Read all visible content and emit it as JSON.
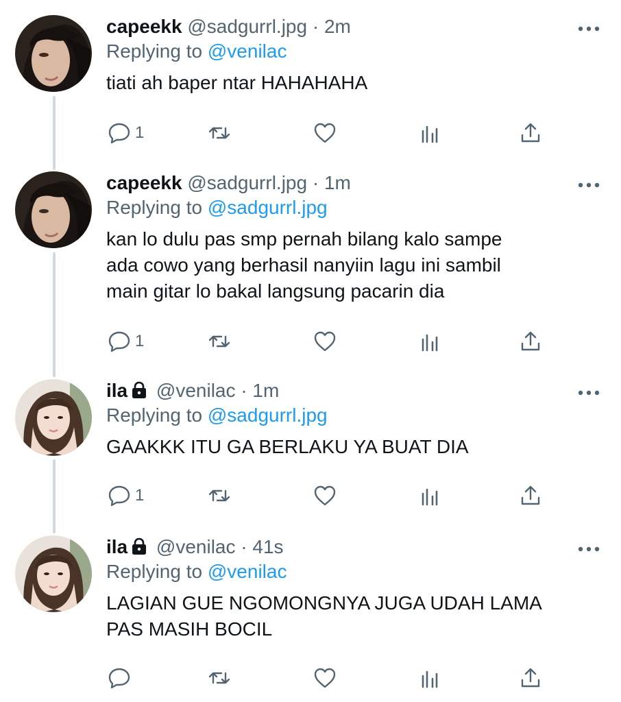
{
  "tweets": [
    {
      "name": "capeekk",
      "protected": false,
      "handle": "@sadgurrl.jpg",
      "sep": "·",
      "time": "2m",
      "replying_label": "Replying to",
      "replying_to": "@venilac",
      "text": "tiati ah baper ntar HAHAHAHA",
      "reply_count": "1",
      "avatar": "dark-hair-selfie"
    },
    {
      "name": "capeekk",
      "protected": false,
      "handle": "@sadgurrl.jpg",
      "sep": "·",
      "time": "1m",
      "replying_label": "Replying to",
      "replying_to": "@sadgurrl.jpg",
      "text": "kan lo dulu pas smp pernah bilang kalo sampe\nada cowo yang berhasil nanyiin lagu ini sambil\nmain gitar lo bakal langsung pacarin dia",
      "reply_count": "1",
      "avatar": "dark-hair-selfie"
    },
    {
      "name": "ila",
      "protected": true,
      "handle": "@venilac",
      "sep": "·",
      "time": "1m",
      "replying_label": "Replying to",
      "replying_to": "@sadgurrl.jpg",
      "text": "GAAKKK ITU GA BERLAKU YA BUAT DIA",
      "reply_count": "1",
      "avatar": "light-portrait"
    },
    {
      "name": "ila",
      "protected": true,
      "handle": "@venilac",
      "sep": "·",
      "time": "41s",
      "replying_label": "Replying to",
      "replying_to": "@venilac",
      "text": "LAGIAN GUE NGOMONGNYA JUGA UDAH LAMA\nPAS MASIH BOCIL",
      "reply_count": "",
      "avatar": "light-portrait"
    }
  ],
  "icons": {
    "reply": "reply-icon",
    "retweet": "retweet-icon",
    "like": "like-icon",
    "analytics": "analytics-icon",
    "share": "share-icon",
    "more": "more-icon",
    "lock": "lock-icon"
  },
  "colors": {
    "link": "#1d9bf0",
    "secondary": "#536471",
    "text": "#0f1419",
    "thread_line": "#cfd9de"
  }
}
